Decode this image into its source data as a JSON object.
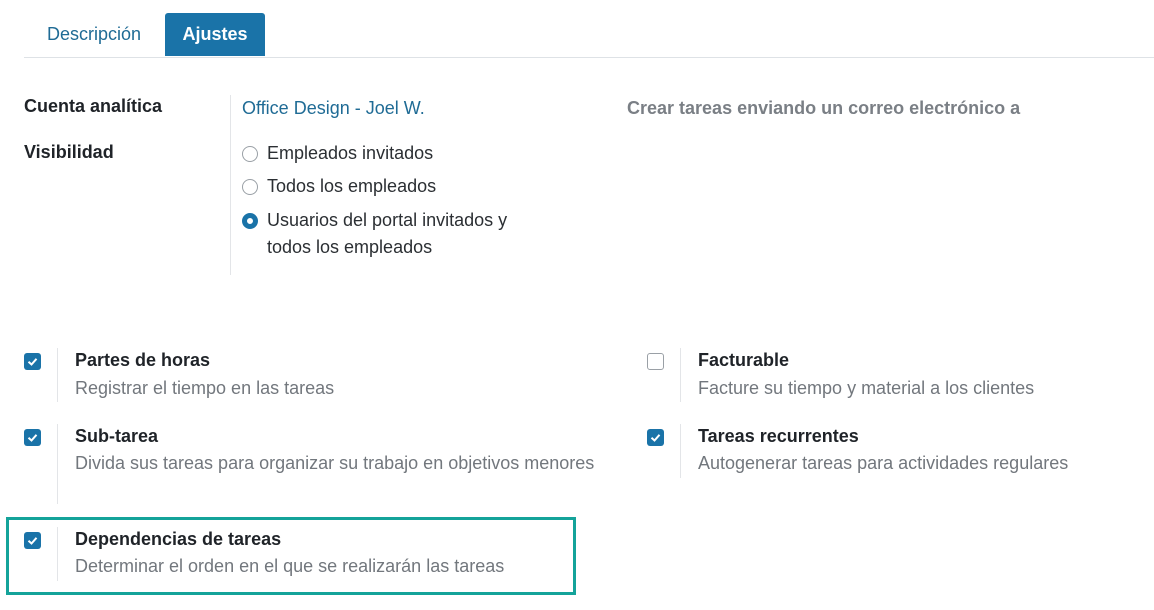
{
  "tabs": [
    {
      "label": "Descripción",
      "active": false
    },
    {
      "label": "Ajustes",
      "active": true
    }
  ],
  "settings": {
    "analytic_account_label": "Cuenta analítica",
    "analytic_account_value": "Office Design - Joel W.",
    "visibility_label": "Visibilidad",
    "visibility_options": [
      {
        "label": "Empleados invitados",
        "selected": false
      },
      {
        "label": "Todos los empleados",
        "selected": false
      },
      {
        "label": "Usuarios del portal invitados y todos los empleados",
        "line1": "Usuarios del portal invitados y",
        "line2": "todos los empleados",
        "selected": true
      }
    ],
    "email_label": "Crear tareas enviando un correo electrónico a"
  },
  "features": [
    {
      "title": "Partes de horas",
      "description": "Registrar el tiempo en las tareas",
      "checked": true
    },
    {
      "title": "Facturable",
      "description": "Facture su tiempo y material a los clientes",
      "checked": false
    },
    {
      "title": "Sub-tarea",
      "description": "Divida sus tareas para organizar su trabajo en objetivos menores",
      "checked": true
    },
    {
      "title": "Tareas recurrentes",
      "description": "Autogenerar tareas para actividades regulares",
      "checked": true
    },
    {
      "title": "Dependencias de tareas",
      "description": "Determinar el orden en el que se realizarán las tareas",
      "checked": true
    }
  ],
  "colors": {
    "primary": "#1a73a8",
    "highlight": "#14a39a"
  },
  "icons": {
    "checkbox_checked": "check-icon"
  }
}
